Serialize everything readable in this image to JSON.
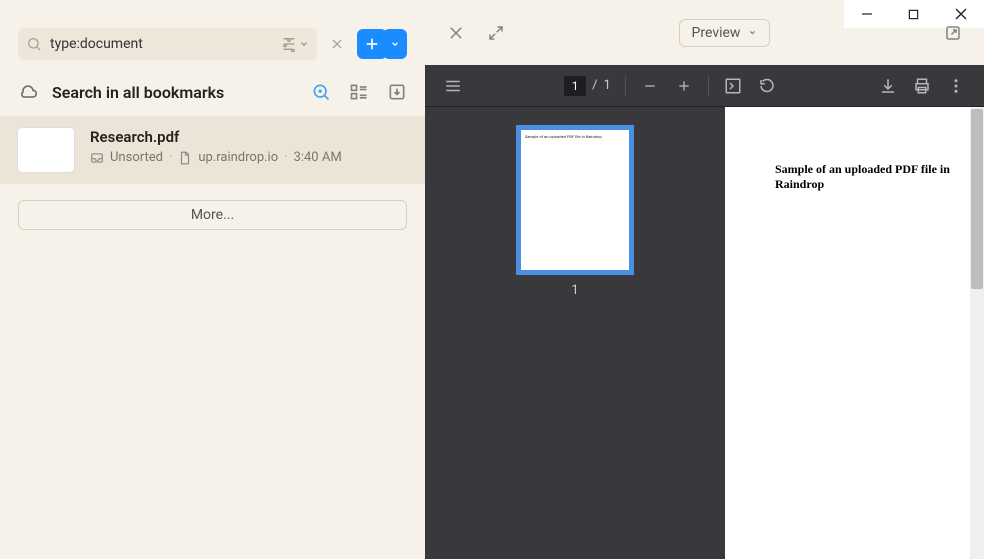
{
  "search": {
    "value": "type:document"
  },
  "header": {
    "title": "Search in all bookmarks"
  },
  "item": {
    "title": "Research.pdf",
    "folder": "Unsorted",
    "domain": "up.raindrop.io",
    "time": "3:40 AM"
  },
  "more_label": "More...",
  "preview": {
    "label": "Preview"
  },
  "pdf": {
    "current_page": "1",
    "total_pages": "1",
    "thumb_label": "1",
    "page_sep": "/",
    "content_text": "Sample of an uploaded PDF file in Raindrop"
  }
}
